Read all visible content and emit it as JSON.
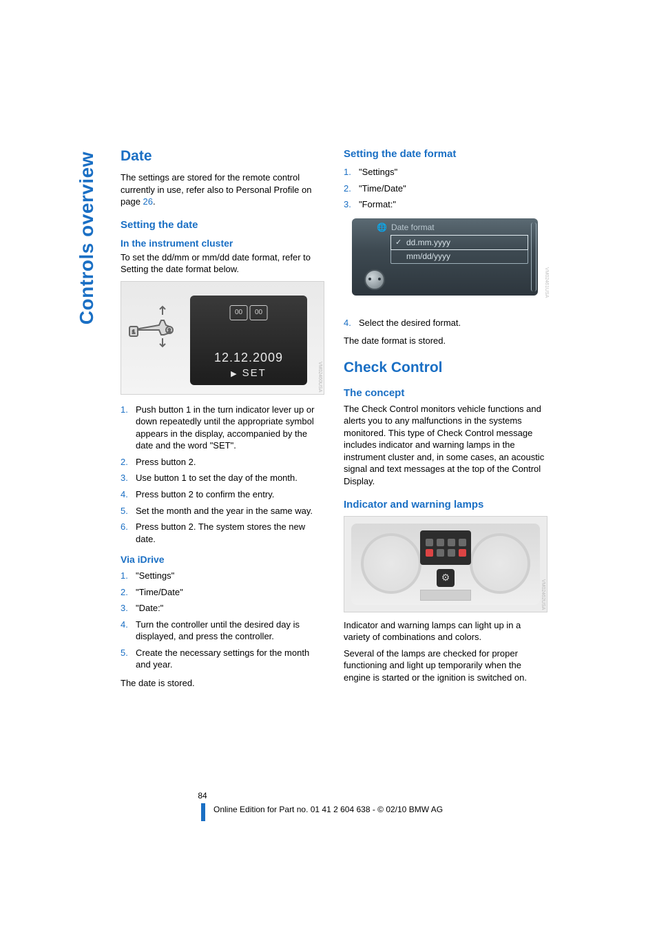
{
  "sideTab": "Controls overview",
  "left": {
    "h1": "Date",
    "intro_pre": "The settings are stored for the remote control currently in use, refer also to Personal Profile on page ",
    "intro_link": "26",
    "intro_post": ".",
    "h2_setting_date": "Setting the date",
    "h3_instrument": "In the instrument cluster",
    "p_instrument": "To set the dd/mm or mm/dd date format, refer to Setting the date format below.",
    "fig1": {
      "icon1": "00",
      "icon2": "00",
      "date": "12.12.2009",
      "set": "SET",
      "cap": "VM02460USA"
    },
    "steps_instrument": [
      "Push button 1 in the turn indicator lever up or down repeatedly until the appropriate symbol appears in the display, accompanied by the date and the word \"SET\".",
      "Press button 2.",
      "Use button 1 to set the day of the month.",
      "Press button 2 to confirm the entry.",
      "Set the month and the year in the same way.",
      "Press button 2.\nThe system stores the new date."
    ],
    "h3_idrive": "Via iDrive",
    "steps_idrive": [
      "\"Settings\"",
      "\"Time/Date\"",
      "\"Date:\"",
      "Turn the controller until the desired day is displayed, and press the controller.",
      "Create the necessary settings for the month and year."
    ],
    "p_date_stored": "The date is stored."
  },
  "right": {
    "h2_setting_format": "Setting the date format",
    "steps_format": [
      "\"Settings\"",
      "\"Time/Date\"",
      "\"Format:\""
    ],
    "fig2": {
      "title": "Date format",
      "opt1": "dd.mm.yyyy",
      "opt2": "mm/dd/yyyy",
      "cap": "VM02461USA"
    },
    "step4": "Select the desired format.",
    "p_format_stored": "The date format is stored.",
    "h1_check": "Check Control",
    "h2_concept": "The concept",
    "p_concept": "The Check Control monitors vehicle functions and alerts you to any malfunctions in the systems monitored. This type of Check Control message includes indicator and warning lamps in the instrument cluster and, in some cases, an acoustic signal and text messages at the top of the Control Display.",
    "h2_lamps": "Indicator and warning lamps",
    "fig3": {
      "cap": "VM02462USA"
    },
    "p_lamps1": "Indicator and warning lamps can light up in a variety of combinations and colors.",
    "p_lamps2": "Several of the lamps are checked for proper functioning and light up temporarily when the engine is started or the ignition is switched on."
  },
  "footer": {
    "page": "84",
    "line": "Online Edition for Part no. 01 41 2 604 638 - © 02/10 BMW AG"
  }
}
